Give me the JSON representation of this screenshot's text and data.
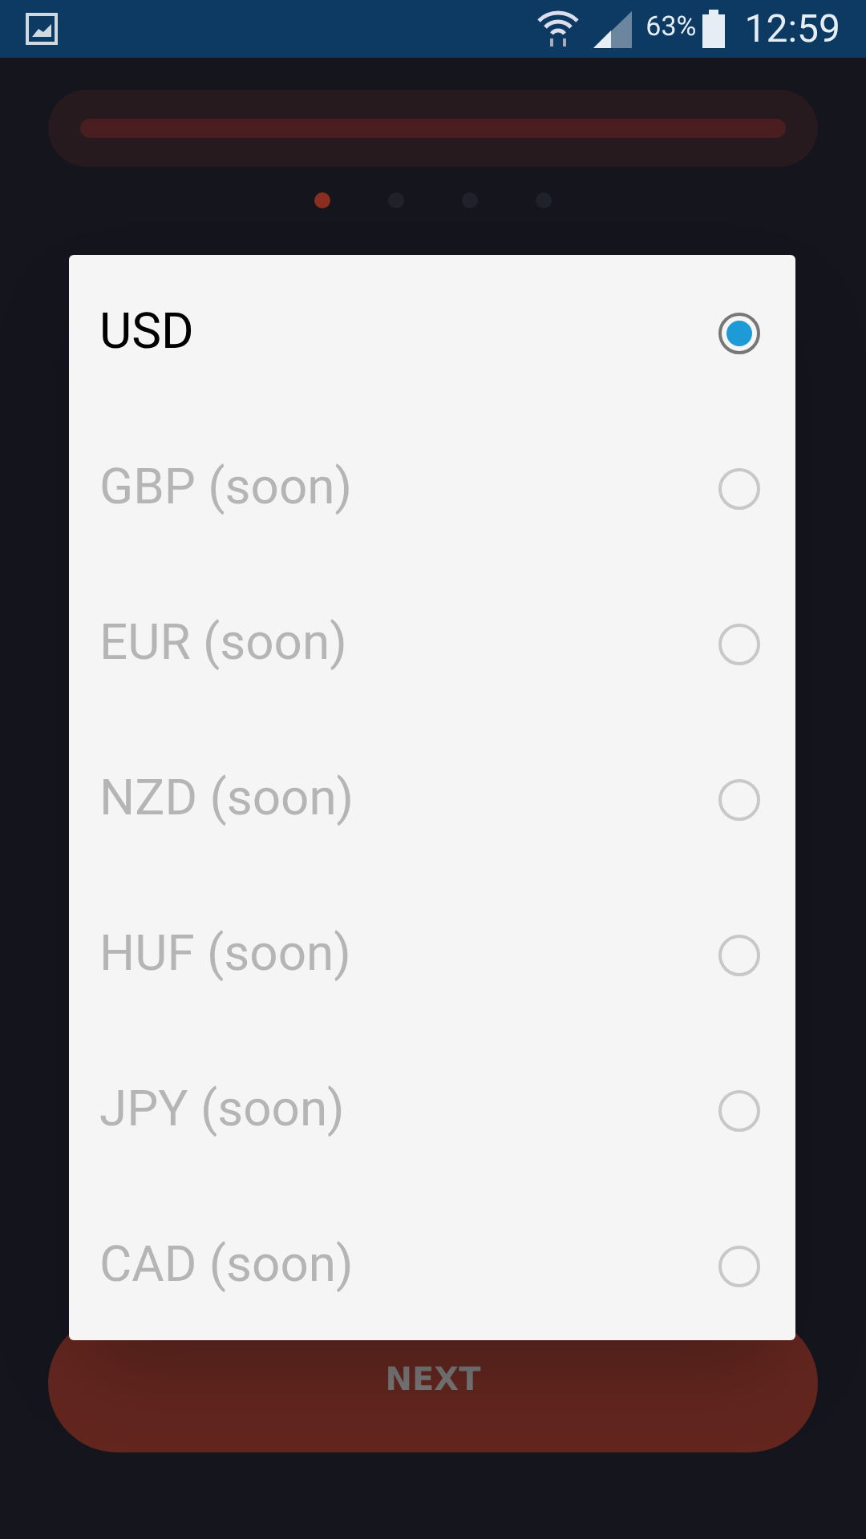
{
  "status_bar": {
    "battery": "63%",
    "time": "12:59"
  },
  "pager": {
    "dots": [
      {
        "selected": true
      },
      {
        "selected": false
      },
      {
        "selected": false
      },
      {
        "selected": false
      }
    ]
  },
  "dialog": {
    "options": [
      {
        "label": "USD",
        "selected": true,
        "disabled": false
      },
      {
        "label": "GBP (soon)",
        "selected": false,
        "disabled": true
      },
      {
        "label": "EUR (soon)",
        "selected": false,
        "disabled": true
      },
      {
        "label": "NZD (soon)",
        "selected": false,
        "disabled": true
      },
      {
        "label": "HUF (soon)",
        "selected": false,
        "disabled": true
      },
      {
        "label": "JPY (soon)",
        "selected": false,
        "disabled": true
      },
      {
        "label": "CAD (soon)",
        "selected": false,
        "disabled": true
      }
    ]
  },
  "next_button": {
    "label": "NEXT"
  }
}
